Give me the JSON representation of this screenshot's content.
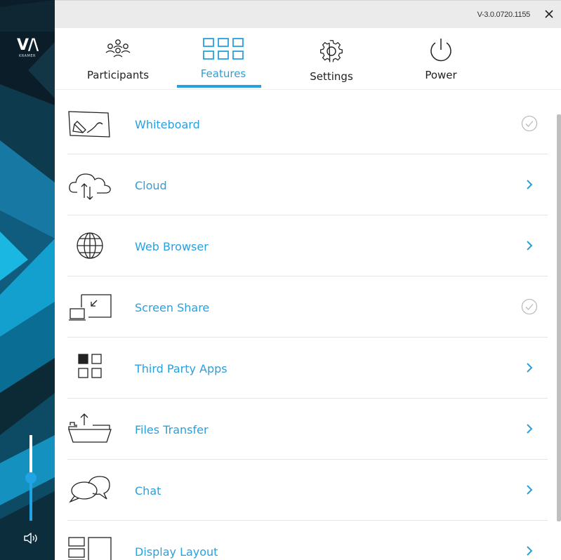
{
  "brand": {
    "logo_text": "V/\\",
    "sub_text": "KRAMER"
  },
  "titlebar": {
    "version": "V-3.0.0720.1155",
    "close_label": "✕"
  },
  "nav": {
    "tabs": [
      {
        "id": "participants",
        "label": "Participants",
        "icon": "participants-icon",
        "active": false
      },
      {
        "id": "features",
        "label": "Features",
        "icon": "grid-icon",
        "active": true
      },
      {
        "id": "settings",
        "label": "Settings",
        "icon": "gear-icon",
        "active": false
      },
      {
        "id": "power",
        "label": "Power",
        "icon": "power-icon",
        "active": false
      }
    ]
  },
  "features": [
    {
      "label": "Whiteboard",
      "icon": "whiteboard-icon",
      "status": "check"
    },
    {
      "label": "Cloud",
      "icon": "cloud-transfer-icon",
      "status": "chevron"
    },
    {
      "label": "Web Browser",
      "icon": "globe-icon",
      "status": "chevron"
    },
    {
      "label": "Screen Share",
      "icon": "screen-share-icon",
      "status": "check"
    },
    {
      "label": "Third Party Apps",
      "icon": "apps-grid-icon",
      "status": "chevron"
    },
    {
      "label": "Files Transfer",
      "icon": "file-transfer-icon",
      "status": "chevron"
    },
    {
      "label": "Chat",
      "icon": "chat-bubbles-icon",
      "status": "chevron"
    },
    {
      "label": "Display Layout",
      "icon": "display-layout-icon",
      "status": "chevron"
    }
  ],
  "volume": {
    "level": 0.5,
    "icon": "speaker-icon"
  },
  "colors": {
    "accent": "#2aa0dc",
    "text": "#222222",
    "check": "#bbbbbb",
    "sidebar": "#0a1a24"
  }
}
